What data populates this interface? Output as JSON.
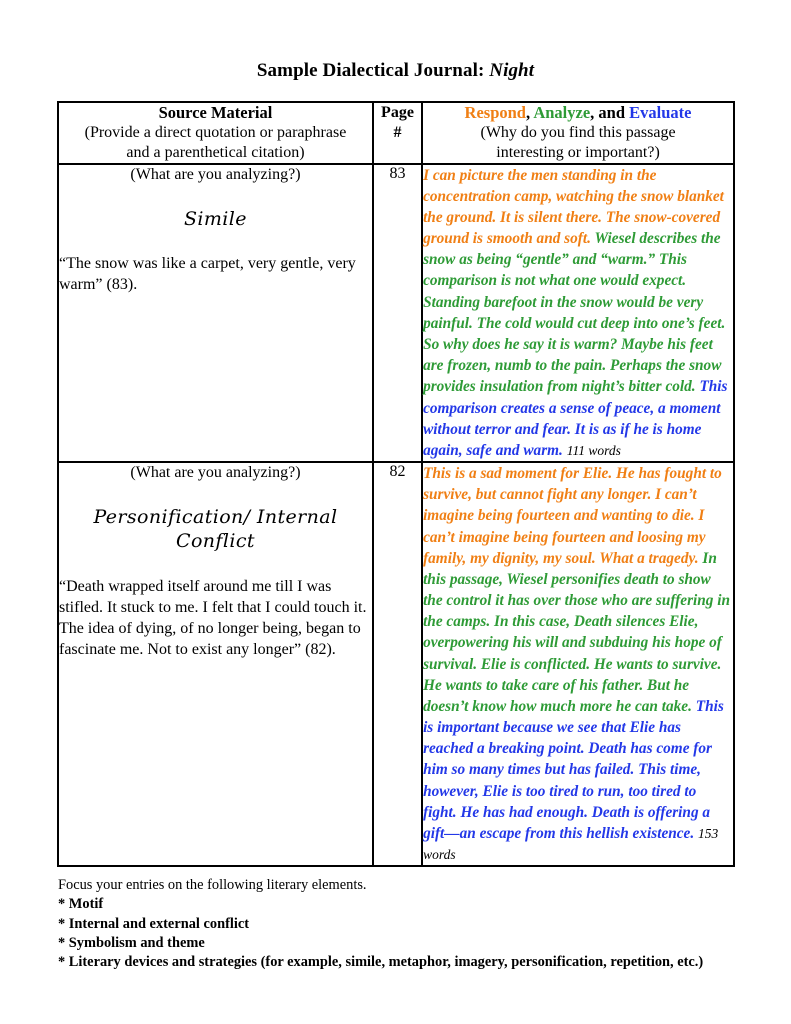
{
  "title": {
    "prefix": "Sample Dialectical Journal:",
    "work": "Night"
  },
  "colors": {
    "respond": "#F07F14",
    "analyze": "#2E9B36",
    "evaluate": "#2338E8",
    "border": "#000000"
  },
  "table": {
    "header": {
      "source_title": "Source Material",
      "source_sub_line1": "(Provide a direct quotation or paraphrase",
      "source_sub_line2": "and a parenthetical citation)",
      "page_label": "Page",
      "page_hash": "#",
      "respond_word": "Respond",
      "comma": ", ",
      "analyze_word": "Analyze",
      "and_word": ", and ",
      "evaluate_word": "Evaluate",
      "respond_sub_line1": "(Why do you find this passage",
      "respond_sub_line2": "interesting or important?)"
    },
    "rows": [
      {
        "prompt": "(What are you analyzing?)",
        "device": "Simile",
        "quote": "“The snow was like a carpet, very gentle, very warm” (83).",
        "page": "83",
        "response": {
          "respond": "I can picture the men standing in the concentration camp, watching the snow blanket the ground.  It is silent there. The snow-covered ground is smooth and soft.  ",
          "analyze": "Wiesel describes the snow as being “gentle” and “warm.”  This comparison is not what one would expect. Standing barefoot in the snow would be very painful.  The cold would cut deep into one’s feet.  So why does he say it is warm?  Maybe his feet are frozen, numb to the pain.  Perhaps the snow provides insulation from night’s bitter cold.  ",
          "evaluate": "This comparison creates a sense of peace, a moment without terror and fear.  It is as if he is home again, safe and warm.",
          "wordcount": "111 words"
        }
      },
      {
        "prompt": "(What are you analyzing?)",
        "device": "Personification/ Internal Conflict",
        "quote": "“Death wrapped itself around me till I was stifled.  It stuck to me.  I felt that I could touch it.  The idea of dying, of no longer being, began to fascinate me.  Not to exist any longer” (82).",
        "page": "82",
        "response": {
          "respond": "This is a sad moment for Elie.  He has fought to survive, but cannot fight any longer.  I can’t imagine being fourteen and wanting to die.  I can’t imagine being fourteen and loosing my family, my dignity, my soul.  What a tragedy.  ",
          "analyze": "In this passage, Wiesel personifies death to show the control it has over those who are suffering in the camps.  In this case, Death silences Elie, overpowering his will and subduing his hope of survival.  Elie is conflicted.  He wants to survive.  He wants to take care of his father.  But he doesn’t know how much more he can take.  ",
          "evaluate": "This is important because we see that Elie has reached a breaking point.  Death has come for him so many times but has failed.  This time, however, Elie is too tired to run, too tired to fight.  He has had enough.  Death is offering a gift—an escape from this hellish existence.",
          "wordcount": "153 words"
        }
      }
    ]
  },
  "footer": {
    "lead": "Focus your entries on the following literary elements.",
    "items": [
      "* Motif",
      "* Internal and external conflict",
      "* Symbolism and theme",
      "* Literary devices and strategies (for example, simile, metaphor, imagery, personification, repetition, etc.)"
    ]
  }
}
